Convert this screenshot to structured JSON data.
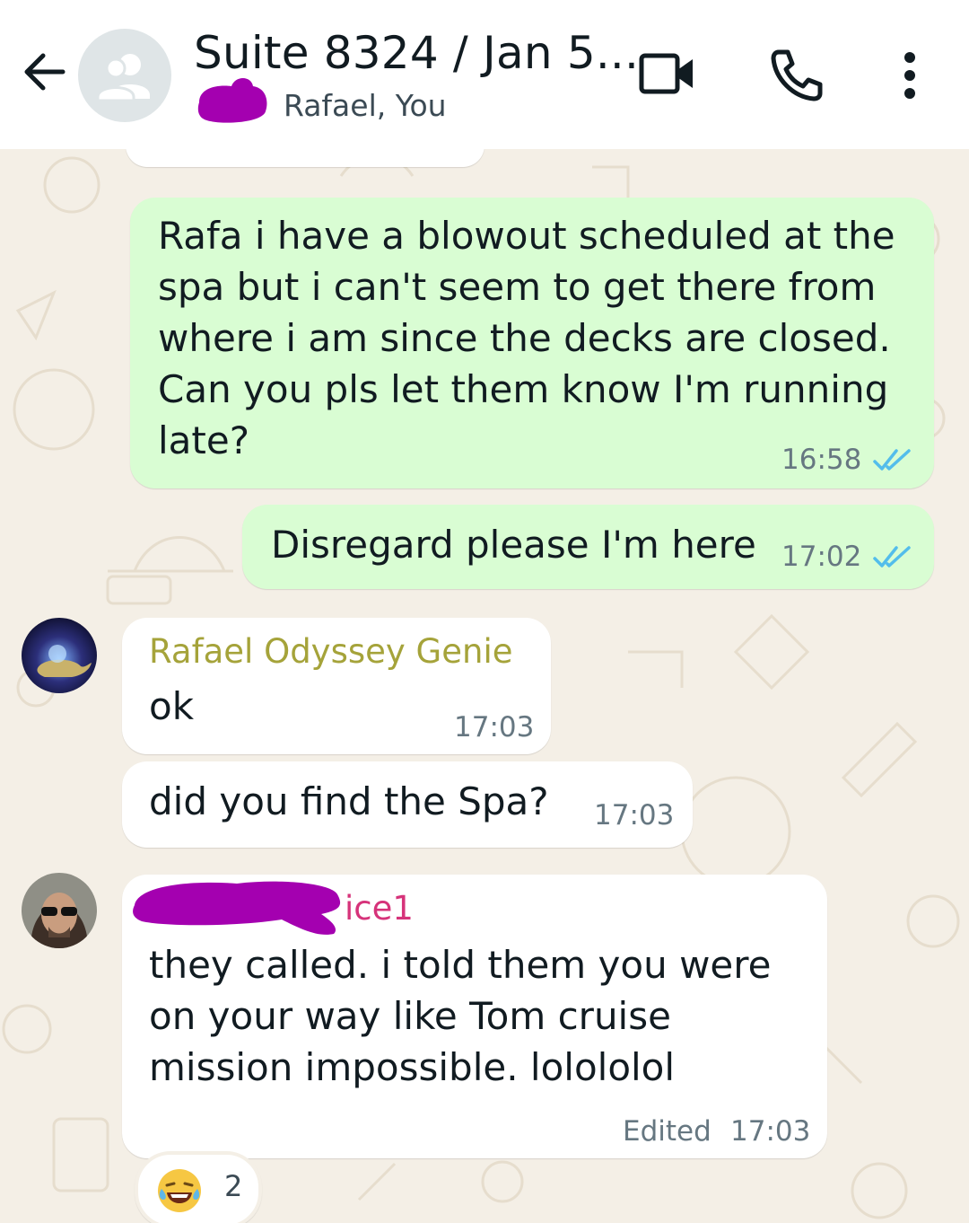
{
  "header": {
    "title": "Suite 8324 / Jan 5...",
    "participants": "Rafael, You",
    "icons": [
      "back-arrow-icon",
      "group-icon",
      "video-call-icon",
      "phone-icon",
      "more-vert-icon"
    ]
  },
  "messages": [
    {
      "direction": "outgoing",
      "lines": [
        "Rafa i have a blowout scheduled at the",
        "spa but i can't seem to get there from",
        "where i am since the decks are closed.",
        "Can you pls let them know I'm running",
        "late?"
      ],
      "time": "16:58",
      "status": "read"
    },
    {
      "direction": "outgoing",
      "text": "Disregard please I'm here",
      "time": "17:02",
      "status": "read"
    },
    {
      "direction": "incoming",
      "sender": "Rafael Odyssey Genie",
      "text": "ok",
      "time": "17:03"
    },
    {
      "direction": "incoming",
      "text": "did you find the Spa?",
      "time": "17:03"
    },
    {
      "direction": "incoming",
      "sender": "ice1",
      "lines": [
        "they called. i told them you were",
        "on your way like Tom cruise",
        "mission impossible.  lolololol"
      ],
      "edited_label": "Edited",
      "time": "17:03",
      "reaction": {
        "emoji": "😂",
        "count": "2"
      }
    }
  ],
  "colors": {
    "outgoing_bubble": "#d9fdd3",
    "incoming_bubble": "#ffffff",
    "wallpaper": "#f4efe6",
    "read_ticks": "#53bdeb",
    "sender_genie": "#a5a33a",
    "sender_ice": "#d6337a",
    "redaction": "#a400b0"
  }
}
